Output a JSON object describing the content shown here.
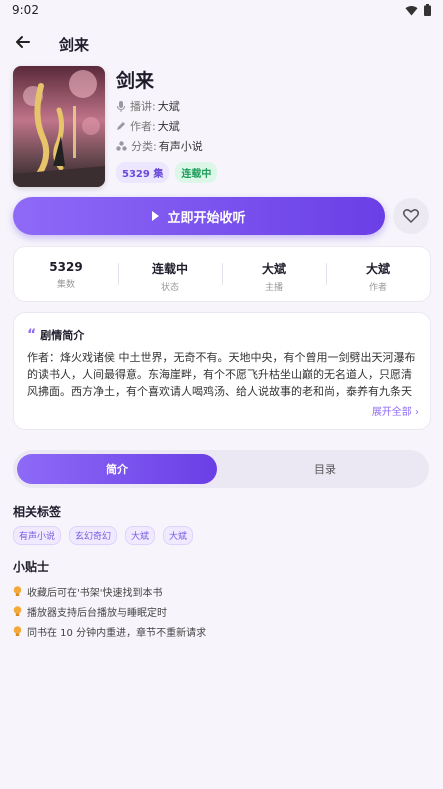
{
  "status_bar": {
    "time": "9:02"
  },
  "app_bar": {
    "title": "剑来"
  },
  "book": {
    "title": "剑来",
    "narrator_label": "播讲:",
    "narrator": "大斌",
    "author_label": "作者:",
    "author": "大斌",
    "category_label": "分类:",
    "category": "有声小说",
    "episodes_badge": "5329 集",
    "status_badge": "连载中"
  },
  "actions": {
    "play_label": "立即开始收听"
  },
  "stats": [
    {
      "value": "5329",
      "label": "集数"
    },
    {
      "value": "连载中",
      "label": "状态"
    },
    {
      "value": "大斌",
      "label": "主播"
    },
    {
      "value": "大斌",
      "label": "作者"
    }
  ],
  "synopsis": {
    "title": "剧情简介",
    "text": "作者：烽火戏诸侯 中土世界，无奇不有。天地中央，有个曾用一剑劈出天河瀑布的读书人，人间最得意。东海崖畔，有个不愿飞升枯坐山巅的无名道人，只愿清风拂面。西方净土，有个喜欢请人喝鸡汤、给人说故事的老和尚，泰养有九条天龙…",
    "expand_label": "展开全部 ›"
  },
  "tabs": [
    {
      "label": "简介"
    },
    {
      "label": "目录"
    }
  ],
  "tags_section": {
    "title": "相关标签",
    "tags": [
      "有声小说",
      "玄幻奇幻",
      "大斌",
      "大斌"
    ]
  },
  "tips_section": {
    "title": "小贴士",
    "tips": [
      "收藏后可在'书架'快速找到本书",
      "播放器支持后台播放与睡眠定时",
      "同书在 10 分钟内重进，章节不重新请求"
    ]
  },
  "colors": {
    "accent": "#7c55ee",
    "accent_light": "#ece6ff",
    "green": "#1f9e5a",
    "background": "#f7f5fb"
  }
}
